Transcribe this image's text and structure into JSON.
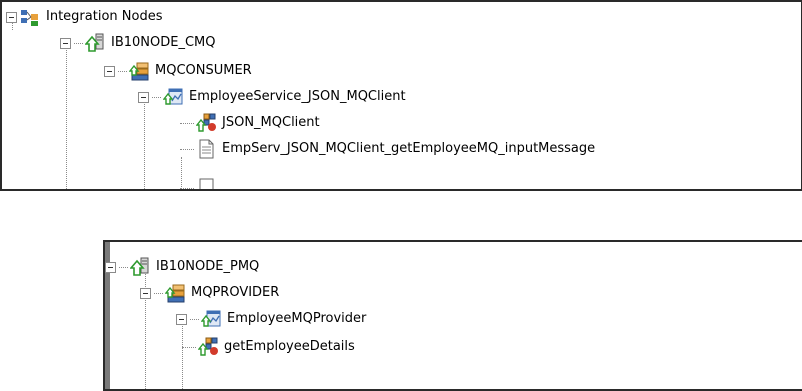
{
  "panel_top": {
    "nodes": [
      {
        "label": "Integration Nodes",
        "icon": "integration-nodes-icon"
      },
      {
        "label": "IB10NODE_CMQ",
        "icon": "integration-node-icon"
      },
      {
        "label": "MQCONSUMER",
        "icon": "integration-server-icon"
      },
      {
        "label": "EmployeeService_JSON_MQClient",
        "icon": "application-icon"
      },
      {
        "label": "JSON_MQClient",
        "icon": "message-flow-icon"
      },
      {
        "label": "EmpServ_JSON_MQClient_getEmployeeMQ_inputMessage",
        "icon": "document-icon"
      }
    ]
  },
  "panel_bottom": {
    "nodes": [
      {
        "label": "IB10NODE_PMQ",
        "icon": "integration-node-icon"
      },
      {
        "label": "MQPROVIDER",
        "icon": "integration-server-icon"
      },
      {
        "label": "EmployeeMQProvider",
        "icon": "application-icon"
      },
      {
        "label": "getEmployeeDetails",
        "icon": "message-flow-icon"
      }
    ]
  },
  "colors": {
    "border": "#2a2a2a",
    "tree_line": "#8a8a8a",
    "arrow_green": "#2e9a2e",
    "server_orange": "#e8a13c",
    "app_blue": "#3f6fb4"
  }
}
